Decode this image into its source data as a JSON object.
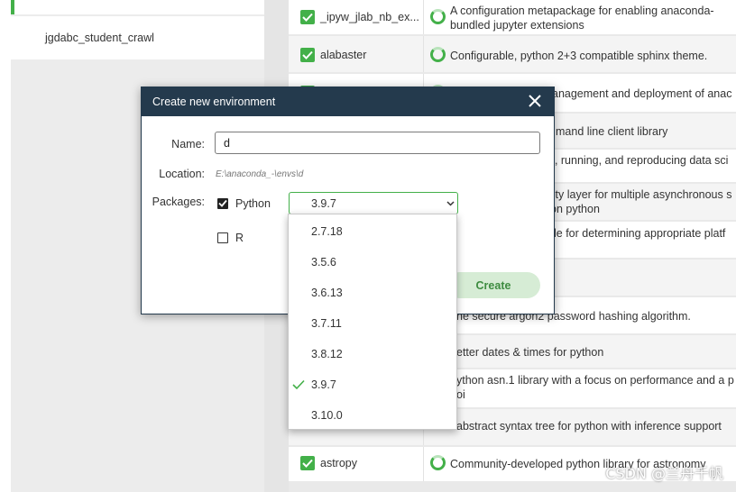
{
  "environments": {
    "items": [
      {
        "label": ""
      },
      {
        "label": "jgdabc_student_crawl"
      }
    ]
  },
  "packages": {
    "rows": [
      {
        "name": "_ipyw_jlab_nb_ex...",
        "checked": true,
        "description": "A configuration metapackage for enabling anaconda-bundled jupyter extensions"
      },
      {
        "name": "alabaster",
        "checked": true,
        "description": "Configurable, python 2+3 compatible sphinx theme."
      },
      {
        "name": "",
        "checked": true,
        "description": "anagement and deployment of anac"
      },
      {
        "name": "",
        "checked": true,
        "description": "mand line client library"
      },
      {
        "name": "",
        "checked": true,
        "description": "g, running, and reproducing data sci"
      },
      {
        "name": "",
        "checked": true,
        "description": "lity layer for multiple asynchronous s on python"
      },
      {
        "name": "",
        "checked": true,
        "description": "le for determining appropriate platf"
      },
      {
        "name": "",
        "checked": false,
        "description": ""
      },
      {
        "name": "",
        "checked": true,
        "description": "he secure argon2 password hashing algorithm."
      },
      {
        "name": "",
        "checked": true,
        "description": "etter dates & times for python"
      },
      {
        "name": "",
        "checked": true,
        "description": "ython asn.1 library with a focus on performance and a p oi"
      },
      {
        "name": "",
        "checked": true,
        "description": "abstract syntax tree for python with inference support"
      },
      {
        "name": "astropy",
        "checked": true,
        "description": "Community-developed python library for astronomy"
      }
    ]
  },
  "dialog": {
    "title": "Create new environment",
    "name_label": "Name:",
    "name_value": "d",
    "location_label": "Location:",
    "location_value": "E:\\anaconda_-\\envs\\d",
    "packages_label": "Packages:",
    "python_label": "Python",
    "python_checked": true,
    "r_label": "R",
    "r_checked": false,
    "python_version_selected": "3.9.7",
    "create_label": "Create"
  },
  "dropdown": {
    "options": [
      "2.7.18",
      "3.5.6",
      "3.6.13",
      "3.7.11",
      "3.8.12",
      "3.9.7",
      "3.10.0"
    ],
    "selected": "3.9.7"
  },
  "watermark": "CSDN @兰舟千帆",
  "colors": {
    "accent_green": "#43b049",
    "dialog_header": "#243a4d",
    "create_button_bg": "#d6ecd5"
  },
  "icons": {
    "close": "close-icon",
    "check": "checkmark-icon",
    "spinner": "status-ring-icon",
    "chevron": "chevron-down-icon"
  }
}
